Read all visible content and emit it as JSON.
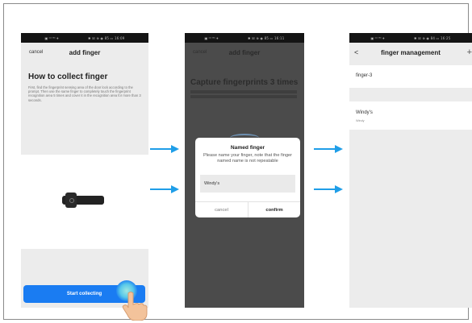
{
  "screen1": {
    "status_left": "▣ ᵃ⁴ ⁶ᴳ ✈",
    "status_right": "✱ ☒ ⊕ ◉ 85 ▭ 16:09",
    "cancel": "cancel",
    "title": "add finger",
    "heading": "How to collect finger",
    "instruction": "First, find the fingerprint sensing area of the door lock according to the prompt. Then use the same finger to completely touch the fingerprint recognition area 5 times and cover it in the recognition area for more than 3 seconds.",
    "start_button": "Start collecting"
  },
  "screen2": {
    "status_left": "▣ ᵃ⁴ ⁶ᴳ ✈",
    "status_right": "✱ ☒ ⊕ ◉ 85 ▭ 16:11",
    "cancel": "cancel",
    "title": "add finger",
    "heading": "Capture fingerprints 3 times",
    "dialog": {
      "title": "Named finger",
      "message": "Please name your finger, note that the finger named name is not repeatable",
      "input_value": "Windy's",
      "cancel": "cancel",
      "confirm": "confirm"
    }
  },
  "screen3": {
    "status_left": "▣ ᵃ⁴ ⁶ᴳ ✈",
    "status_right": "✱ ☒ ⊕ ◉ 84 ▭ 16:25",
    "back": "<",
    "title": "finger management",
    "add": "+",
    "fingers": [
      {
        "name": "finger-3",
        "sub": ""
      },
      {
        "name": "Windy's",
        "sub": "Windy"
      }
    ]
  },
  "colors": {
    "accent": "#1a7cf2",
    "arrow": "#1f9ee8"
  },
  "icons": {
    "arrow": "right-arrow-icon",
    "hand": "pointing-hand-icon",
    "handle": "door-lock-handle-icon"
  }
}
